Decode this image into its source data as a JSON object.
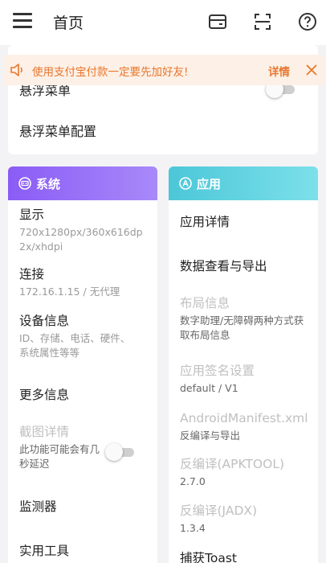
{
  "appbar": {
    "title": "首页",
    "icons": [
      "menu-icon",
      "wallet-icon",
      "scan-icon",
      "help-icon"
    ]
  },
  "notice": {
    "text": "使用支付宝付款一定要先加好友!",
    "link": "详情",
    "color": "#e8772e",
    "background": "#fdf0e6"
  },
  "top_card": {
    "floating_menu": "悬浮菜单",
    "floating_menu_enabled": false,
    "floating_menu_config": "悬浮菜单配置"
  },
  "system": {
    "title": "系统",
    "icon": "robot-face-icon",
    "accent": "#8a5cf6",
    "display": {
      "label": "显示",
      "sub": "720x1280px/360x616dp 2x/xhdpi"
    },
    "connection": {
      "label": "连接",
      "sub": "172.16.1.15 / 无代理"
    },
    "device_info": {
      "label": "设备信息",
      "sub": "ID、存储、电话、硬件、系统属性等等"
    },
    "more_info": {
      "label": "更多信息"
    },
    "screenshot_detail": {
      "label": "截图详情",
      "sub": "此功能可能会有几秒延迟",
      "enabled": false
    },
    "monitor": {
      "label": "监测器"
    },
    "tools": {
      "label": "实用工具"
    }
  },
  "apps": {
    "title": "应用",
    "icon": "compass-icon",
    "accent": "#4cc7d8",
    "app_detail": {
      "label": "应用详情"
    },
    "data_export": {
      "label": "数据查看与导出"
    },
    "layout_info": {
      "label": "布局信息",
      "sub": "数字助理/无障碍两种方式获取布局信息"
    },
    "signature": {
      "label": "应用签名设置",
      "sub": "default / V1"
    },
    "manifest": {
      "label": "AndroidManifest.xml",
      "sub": "反编译与导出"
    },
    "apktool": {
      "label": "反编译(APKTOOL)",
      "sub": "2.7.0"
    },
    "jadx": {
      "label": "反编译(JADX)",
      "sub": "1.3.4"
    },
    "capture_toast": {
      "label": "捕获Toast"
    }
  }
}
